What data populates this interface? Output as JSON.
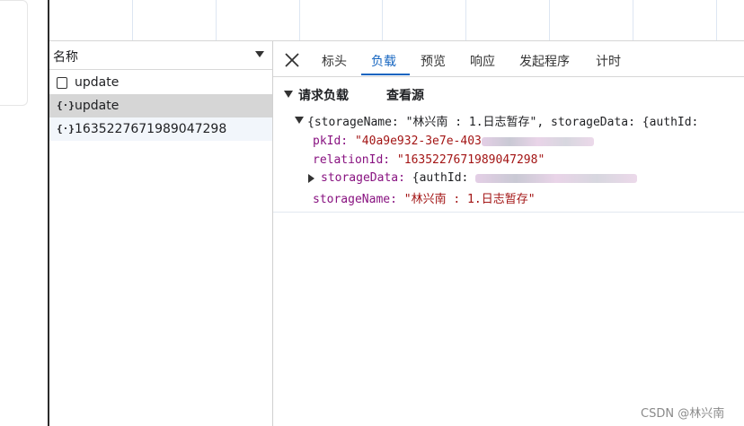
{
  "request_list": {
    "column_header": "名称",
    "rows": [
      {
        "name": "update",
        "icon": "document-icon"
      },
      {
        "name": "update",
        "icon": "json-braces-icon"
      },
      {
        "name": "1635227671989047298",
        "icon": "json-braces-icon"
      }
    ]
  },
  "detail": {
    "tabs": [
      {
        "label": "标头"
      },
      {
        "label": "负载"
      },
      {
        "label": "预览"
      },
      {
        "label": "响应"
      },
      {
        "label": "发起程序"
      },
      {
        "label": "计时"
      }
    ],
    "active_tab": "负载",
    "payload_section": "请求负载",
    "view_source": "查看源",
    "payload": {
      "summary_prefix": "{storageName: \"林兴南 : 1.日志暂存\", storageData: {authId:",
      "pkId_key": "pkId:",
      "pkId_value": "\"40a9e932-3e7e-403",
      "relationId_key": "relationId:",
      "relationId_value": "\"1635227671989047298\"",
      "storageData_key": "storageData:",
      "storageData_value": "{authId:",
      "storageName_key": "storageName:",
      "storageName_value": "\"林兴南 : 1.日志暂存\""
    }
  },
  "watermark": "CSDN @林兴南",
  "colors": {
    "accent": "#1565c0",
    "key": "#881280",
    "string": "#a31515",
    "selected_row": "#d6d6d6"
  }
}
